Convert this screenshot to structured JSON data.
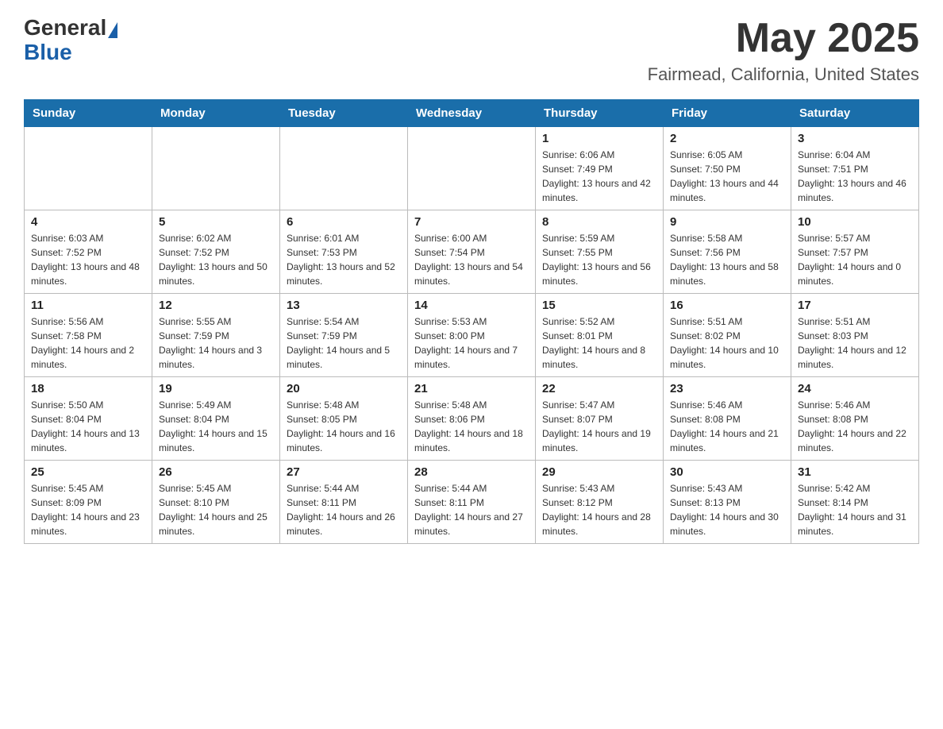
{
  "header": {
    "logo": {
      "general": "General",
      "blue": "Blue"
    },
    "title": "May 2025",
    "location": "Fairmead, California, United States"
  },
  "days_of_week": [
    "Sunday",
    "Monday",
    "Tuesday",
    "Wednesday",
    "Thursday",
    "Friday",
    "Saturday"
  ],
  "weeks": [
    [
      {
        "day": "",
        "info": ""
      },
      {
        "day": "",
        "info": ""
      },
      {
        "day": "",
        "info": ""
      },
      {
        "day": "",
        "info": ""
      },
      {
        "day": "1",
        "info": "Sunrise: 6:06 AM\nSunset: 7:49 PM\nDaylight: 13 hours and 42 minutes."
      },
      {
        "day": "2",
        "info": "Sunrise: 6:05 AM\nSunset: 7:50 PM\nDaylight: 13 hours and 44 minutes."
      },
      {
        "day": "3",
        "info": "Sunrise: 6:04 AM\nSunset: 7:51 PM\nDaylight: 13 hours and 46 minutes."
      }
    ],
    [
      {
        "day": "4",
        "info": "Sunrise: 6:03 AM\nSunset: 7:52 PM\nDaylight: 13 hours and 48 minutes."
      },
      {
        "day": "5",
        "info": "Sunrise: 6:02 AM\nSunset: 7:52 PM\nDaylight: 13 hours and 50 minutes."
      },
      {
        "day": "6",
        "info": "Sunrise: 6:01 AM\nSunset: 7:53 PM\nDaylight: 13 hours and 52 minutes."
      },
      {
        "day": "7",
        "info": "Sunrise: 6:00 AM\nSunset: 7:54 PM\nDaylight: 13 hours and 54 minutes."
      },
      {
        "day": "8",
        "info": "Sunrise: 5:59 AM\nSunset: 7:55 PM\nDaylight: 13 hours and 56 minutes."
      },
      {
        "day": "9",
        "info": "Sunrise: 5:58 AM\nSunset: 7:56 PM\nDaylight: 13 hours and 58 minutes."
      },
      {
        "day": "10",
        "info": "Sunrise: 5:57 AM\nSunset: 7:57 PM\nDaylight: 14 hours and 0 minutes."
      }
    ],
    [
      {
        "day": "11",
        "info": "Sunrise: 5:56 AM\nSunset: 7:58 PM\nDaylight: 14 hours and 2 minutes."
      },
      {
        "day": "12",
        "info": "Sunrise: 5:55 AM\nSunset: 7:59 PM\nDaylight: 14 hours and 3 minutes."
      },
      {
        "day": "13",
        "info": "Sunrise: 5:54 AM\nSunset: 7:59 PM\nDaylight: 14 hours and 5 minutes."
      },
      {
        "day": "14",
        "info": "Sunrise: 5:53 AM\nSunset: 8:00 PM\nDaylight: 14 hours and 7 minutes."
      },
      {
        "day": "15",
        "info": "Sunrise: 5:52 AM\nSunset: 8:01 PM\nDaylight: 14 hours and 8 minutes."
      },
      {
        "day": "16",
        "info": "Sunrise: 5:51 AM\nSunset: 8:02 PM\nDaylight: 14 hours and 10 minutes."
      },
      {
        "day": "17",
        "info": "Sunrise: 5:51 AM\nSunset: 8:03 PM\nDaylight: 14 hours and 12 minutes."
      }
    ],
    [
      {
        "day": "18",
        "info": "Sunrise: 5:50 AM\nSunset: 8:04 PM\nDaylight: 14 hours and 13 minutes."
      },
      {
        "day": "19",
        "info": "Sunrise: 5:49 AM\nSunset: 8:04 PM\nDaylight: 14 hours and 15 minutes."
      },
      {
        "day": "20",
        "info": "Sunrise: 5:48 AM\nSunset: 8:05 PM\nDaylight: 14 hours and 16 minutes."
      },
      {
        "day": "21",
        "info": "Sunrise: 5:48 AM\nSunset: 8:06 PM\nDaylight: 14 hours and 18 minutes."
      },
      {
        "day": "22",
        "info": "Sunrise: 5:47 AM\nSunset: 8:07 PM\nDaylight: 14 hours and 19 minutes."
      },
      {
        "day": "23",
        "info": "Sunrise: 5:46 AM\nSunset: 8:08 PM\nDaylight: 14 hours and 21 minutes."
      },
      {
        "day": "24",
        "info": "Sunrise: 5:46 AM\nSunset: 8:08 PM\nDaylight: 14 hours and 22 minutes."
      }
    ],
    [
      {
        "day": "25",
        "info": "Sunrise: 5:45 AM\nSunset: 8:09 PM\nDaylight: 14 hours and 23 minutes."
      },
      {
        "day": "26",
        "info": "Sunrise: 5:45 AM\nSunset: 8:10 PM\nDaylight: 14 hours and 25 minutes."
      },
      {
        "day": "27",
        "info": "Sunrise: 5:44 AM\nSunset: 8:11 PM\nDaylight: 14 hours and 26 minutes."
      },
      {
        "day": "28",
        "info": "Sunrise: 5:44 AM\nSunset: 8:11 PM\nDaylight: 14 hours and 27 minutes."
      },
      {
        "day": "29",
        "info": "Sunrise: 5:43 AM\nSunset: 8:12 PM\nDaylight: 14 hours and 28 minutes."
      },
      {
        "day": "30",
        "info": "Sunrise: 5:43 AM\nSunset: 8:13 PM\nDaylight: 14 hours and 30 minutes."
      },
      {
        "day": "31",
        "info": "Sunrise: 5:42 AM\nSunset: 8:14 PM\nDaylight: 14 hours and 31 minutes."
      }
    ]
  ]
}
